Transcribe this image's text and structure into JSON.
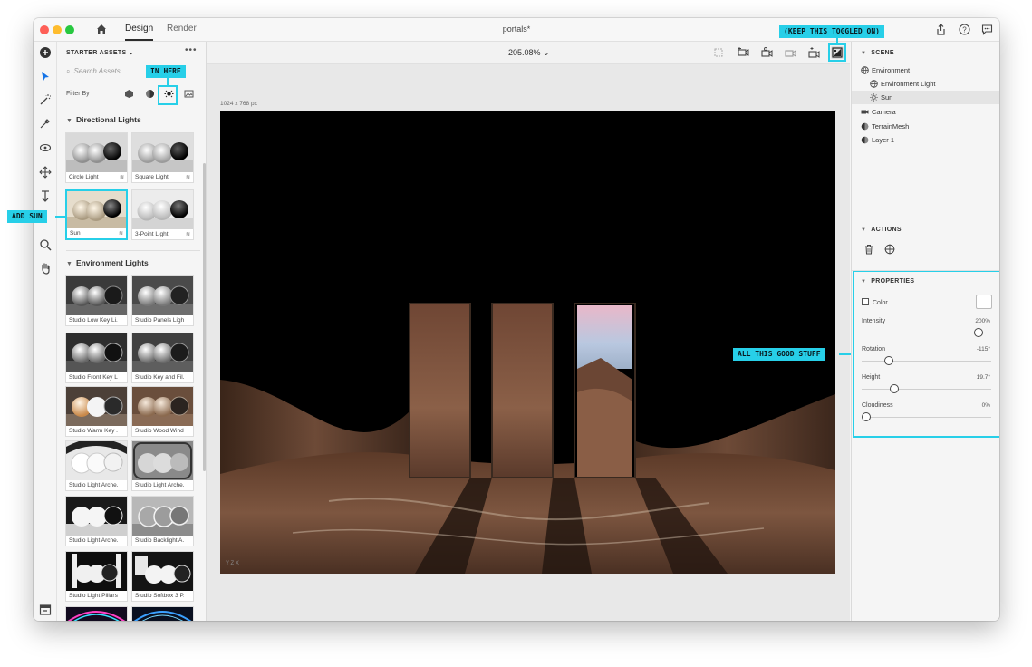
{
  "window": {
    "tabs": [
      "Design",
      "Render"
    ],
    "document_title": "portals*"
  },
  "assets": {
    "title": "STARTER ASSETS",
    "search_placeholder": "Search Assets...",
    "filter_label": "Filter By",
    "sections": [
      {
        "title": "Directional Lights",
        "items": [
          "Circle Light",
          "Square Light",
          "Sun",
          "3-Point Light"
        ]
      },
      {
        "title": "Environment Lights",
        "items": [
          "Studio Low Key Li...",
          "Studio Panels Light",
          "Studio Front Key L...",
          "Studio Key and Fil...",
          "Studio Warm Key ...",
          "Studio Wood Wind...",
          "Studio Light Arche...",
          "Studio Light Arche...",
          "Studio Light Arche...",
          "Studio Backlight A...",
          "Studio Light Pillars...",
          "Studio Softbox 3 P..."
        ]
      }
    ]
  },
  "canvas": {
    "zoom": "205.08%",
    "size_label": "1024 x 768 px",
    "axis_label": "Y Z X"
  },
  "scene": {
    "title": "SCENE",
    "items": [
      "Environment",
      "Environment Light",
      "Sun",
      "Camera",
      "TerrainMesh",
      "Layer 1"
    ],
    "selected": "Sun"
  },
  "actions": {
    "title": "ACTIONS"
  },
  "properties": {
    "title": "PROPERTIES",
    "color_label": "Color",
    "sliders": [
      {
        "label": "Intensity",
        "value": "200%",
        "position": 0.93
      },
      {
        "label": "Rotation",
        "value": "-115°",
        "position": 0.19
      },
      {
        "label": "Height",
        "value": "19.7°",
        "position": 0.23
      },
      {
        "label": "Cloudiness",
        "value": "0%",
        "position": 0.0
      }
    ]
  },
  "callouts": {
    "in_here": "IN HERE",
    "add_sun": "ADD SUN",
    "keep_toggled": "(KEEP THIS TOGGLED ON)",
    "all_this": "ALL THIS GOOD STUFF"
  },
  "colors": {
    "accent": "#27cfe8"
  }
}
